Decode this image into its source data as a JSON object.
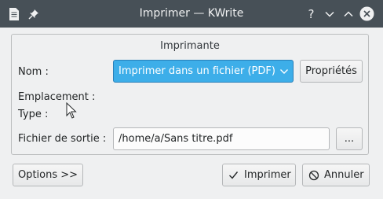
{
  "window": {
    "title": "Imprimer — KWrite",
    "help_symbol": "?"
  },
  "group": {
    "title": "Imprimante"
  },
  "printer": {
    "name_label": "Nom :",
    "selected": "Imprimer dans un fichier (PDF)",
    "properties_label": "Propriétés",
    "location_label": "Emplacement :",
    "type_label": "Type :",
    "output_label": "Fichier de sortie :",
    "output_value": "/home/a/Sans titre.pdf",
    "browse_label": "..."
  },
  "footer": {
    "options_label": "Options >>",
    "print_label": "Imprimer",
    "cancel_label": "Annuler"
  },
  "colors": {
    "titlebar": "#475057",
    "accent": "#3daee9",
    "close": "#3daee9"
  }
}
